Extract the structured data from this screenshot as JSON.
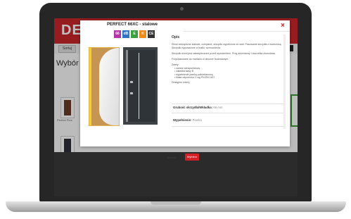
{
  "site": {
    "logo_text": "DE",
    "menu_label": "Sortuj",
    "page_title": "Wybór",
    "thumb_label": "Perfect Plus"
  },
  "modal": {
    "title": "PERFECT 66XC - stalowe",
    "close_glyph": "×",
    "badges": [
      {
        "label": "66",
        "color": "#b535a6"
      },
      {
        "label": "dB",
        "color": "#3073c4"
      },
      {
        "label": "E",
        "color": "#3aa042"
      },
      {
        "label": "K",
        "color": "#f08a1d"
      },
      {
        "label": "CE",
        "color": "#333333"
      }
    ],
    "section_title": "Opis",
    "paragraphs": [
      "Drzwi zewnętrzne stalowe, ocieplane, skrzydło wypełnione ze stali. Pasowanie skrzydła z ościeżnicą. Skrzydło wyposażone w kratki, wzmocnienia.",
      "Skrzydło drzwi jest zabezpieczone przed wyważeniem. Próg aluminiowy. Uszczelka obwodowa.",
      "Przystosowane do montażu w otworze budowlanym."
    ],
    "list_title": "Zalety:",
    "list_items": [
      "• zamek wielopunktowy",
      "• wkładka klasy B",
      "• wypełnienie pianką poliuretanową",
      "• klasa odporności 2 wg PN-EN 1627"
    ],
    "extra_text": "Dostępne kolory:",
    "field1_label": "Grubość skrzydła/Wkładka:",
    "field1_value": "66 mm",
    "field2_label": "Wypełnienie:",
    "field2_value": "Pianka",
    "back_label": "wstecz",
    "choose_label": "Wybierz"
  }
}
